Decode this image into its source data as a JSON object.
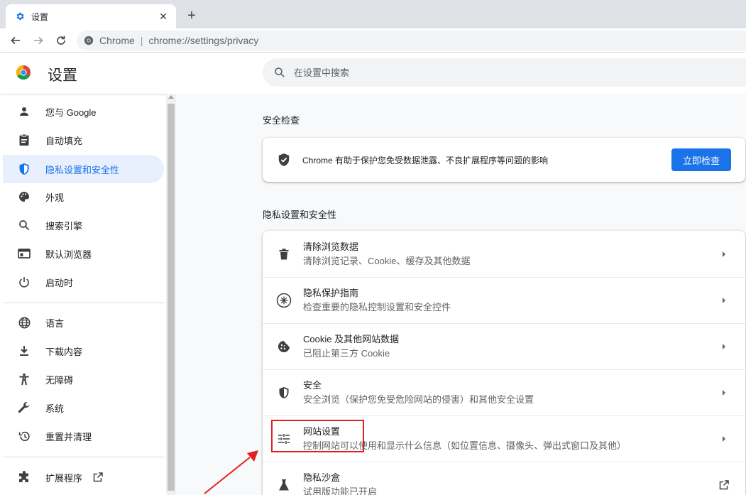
{
  "tab": {
    "title": "设置",
    "close": "✕",
    "new_tab": "+"
  },
  "toolbar": {
    "host": "Chrome",
    "separator": "|",
    "url": "chrome://settings/privacy"
  },
  "header": {
    "title": "设置",
    "search_placeholder": "在设置中搜索"
  },
  "sidebar": {
    "items": [
      {
        "label": "您与 Google",
        "icon": "person-icon"
      },
      {
        "label": "自动填充",
        "icon": "clipboard-icon"
      },
      {
        "label": "隐私设置和安全性",
        "icon": "shield-icon",
        "active": true
      },
      {
        "label": "外观",
        "icon": "palette-icon"
      },
      {
        "label": "搜索引擎",
        "icon": "search-icon"
      },
      {
        "label": "默认浏览器",
        "icon": "browser-icon"
      },
      {
        "label": "启动时",
        "icon": "power-icon"
      },
      {
        "label": "语言",
        "icon": "globe-icon"
      },
      {
        "label": "下载内容",
        "icon": "download-icon"
      },
      {
        "label": "无障碍",
        "icon": "accessibility-icon"
      },
      {
        "label": "系统",
        "icon": "wrench-icon"
      },
      {
        "label": "重置并清理",
        "icon": "restore-icon"
      },
      {
        "label": "扩展程序",
        "icon": "puzzle-icon"
      }
    ]
  },
  "safety_check": {
    "section_title": "安全检查",
    "text": "Chrome 有助于保护您免受数据泄露、不良扩展程序等问题的影响",
    "button": "立即检查"
  },
  "privacy": {
    "section_title": "隐私设置和安全性",
    "rows": [
      {
        "title": "清除浏览数据",
        "subtitle": "清除浏览记录、Cookie、缓存及其他数据",
        "icon": "trash-icon"
      },
      {
        "title": "隐私保护指南",
        "subtitle": "检查重要的隐私控制设置和安全控件",
        "icon": "compass-icon"
      },
      {
        "title": "Cookie 及其他网站数据",
        "subtitle": "已阻止第三方 Cookie",
        "icon": "cookie-icon"
      },
      {
        "title": "安全",
        "subtitle": "安全浏览（保护您免受危险网站的侵害）和其他安全设置",
        "icon": "shield-icon"
      },
      {
        "title": "网站设置",
        "subtitle": "控制网站可以使用和显示什么信息（如位置信息、摄像头、弹出式窗口及其他）",
        "icon": "tune-icon"
      },
      {
        "title": "隐私沙盒",
        "subtitle": "试用版功能已开启",
        "icon": "flask-icon"
      }
    ]
  },
  "colors": {
    "accent": "#1a73e8",
    "annotation": "#e02020",
    "active_bg": "#e8f0fe"
  }
}
